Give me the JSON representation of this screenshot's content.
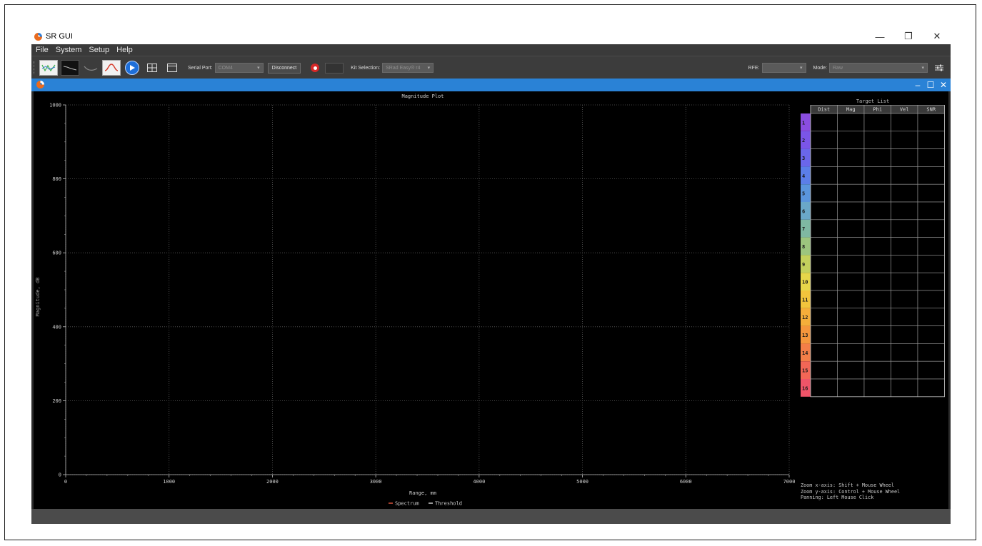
{
  "window": {
    "title": "SR GUI",
    "minimize": "—",
    "maximize": "❐",
    "close": "✕"
  },
  "menu": [
    "File",
    "System",
    "Setup",
    "Help"
  ],
  "toolbar": {
    "serial_port_label": "Serial Port:",
    "serial_port_value": "COM4",
    "disconnect_label": "Disconnect",
    "kit_selection_label": "Kit Selection:",
    "kit_selection_value": "SRad Easy® r4",
    "rfe_label": "RFE:",
    "rfe_value": "",
    "mode_label": "Mode:",
    "mode_value": "Raw"
  },
  "subwindow": {
    "minimize": "–",
    "maximize": "☐",
    "close": "✕"
  },
  "plot": {
    "title": "Magnitude Plot",
    "xlabel": "Range, mm",
    "ylabel": "Magnitude, dB",
    "legend": [
      {
        "name": "Spectrum",
        "color": "#d9533a"
      },
      {
        "name": "Threshold",
        "color": "#c8c8c8"
      }
    ]
  },
  "chart_data": {
    "type": "line",
    "title": "Magnitude Plot",
    "xlabel": "Range, mm",
    "ylabel": "Magnitude, dB",
    "xlim": [
      0,
      7000
    ],
    "ylim": [
      0,
      1000
    ],
    "xticks": [
      0,
      1000,
      2000,
      3000,
      4000,
      5000,
      6000,
      7000
    ],
    "yticks": [
      0,
      200,
      400,
      600,
      800,
      1000
    ],
    "grid": true,
    "legend_position": "bottom",
    "series": [
      {
        "name": "Spectrum",
        "values": []
      },
      {
        "name": "Threshold",
        "values": []
      }
    ]
  },
  "target_list": {
    "title": "Target List",
    "columns": [
      "Dist",
      "Mag",
      "Phi",
      "Vel",
      "SNR"
    ],
    "rows": [
      "1",
      "2",
      "3",
      "4",
      "5",
      "6",
      "7",
      "8",
      "9",
      "10",
      "11",
      "12",
      "13",
      "14",
      "15",
      "16"
    ],
    "row_colors": [
      "#8a4de0",
      "#7a55e8",
      "#6a66ea",
      "#5b7ee8",
      "#5a95dc",
      "#6aa8c8",
      "#7fb8a2",
      "#9cc57e",
      "#c3d05c",
      "#e6d64a",
      "#f2c43c",
      "#f5ae3a",
      "#f5963c",
      "#f47e48",
      "#f26656",
      "#ef5468"
    ]
  },
  "hints": [
    "Zoom x-axis: Shift + Mouse Wheel",
    "Zoom y-axis: Control + Mouse Wheel",
    "Panning: Left Mouse Click"
  ]
}
